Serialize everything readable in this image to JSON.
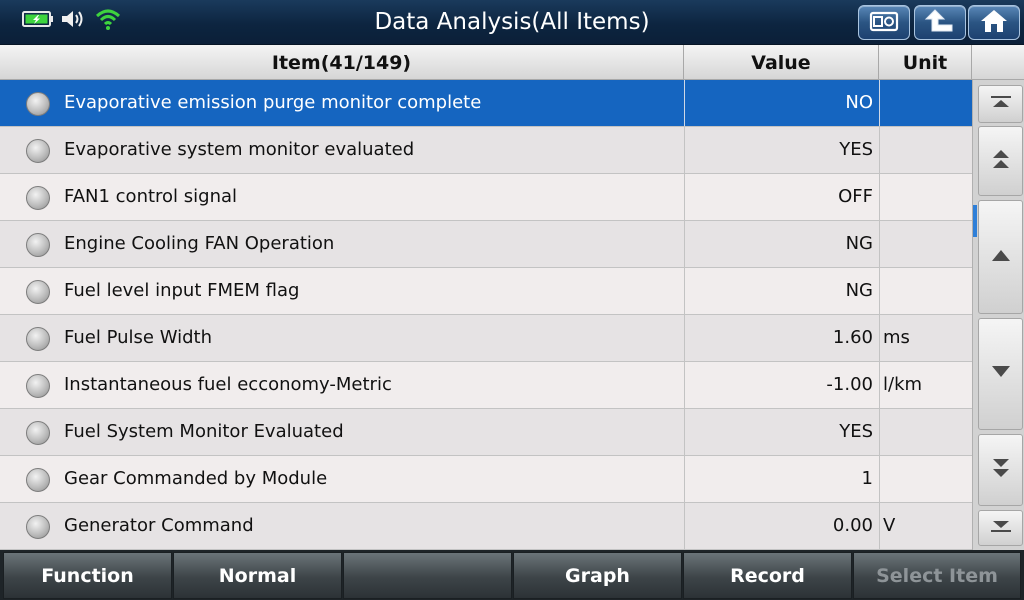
{
  "window": {
    "title": "Data Analysis(All Items)"
  },
  "status_icons": [
    "battery-charging-icon",
    "speaker-icon",
    "wifi-icon"
  ],
  "toolbar": {
    "buttons": [
      "screenshot-icon",
      "upload-icon",
      "home-icon"
    ]
  },
  "table": {
    "headers": {
      "item": "Item(41/149)",
      "value": "Value",
      "unit": "Unit"
    },
    "selected_index": 0,
    "rows": [
      {
        "item": "Evaporative emission purge monitor complete",
        "value": "NO",
        "unit": ""
      },
      {
        "item": "Evaporative system monitor evaluated",
        "value": "YES",
        "unit": ""
      },
      {
        "item": "FAN1 control signal",
        "value": "OFF",
        "unit": ""
      },
      {
        "item": "Engine Cooling FAN Operation",
        "value": "NG",
        "unit": ""
      },
      {
        "item": "Fuel level input FMEM flag",
        "value": "NG",
        "unit": ""
      },
      {
        "item": "Fuel Pulse Width",
        "value": "1.60",
        "unit": "ms"
      },
      {
        "item": "Instantaneous fuel ecconomy-Metric",
        "value": "-1.00",
        "unit": "l/km"
      },
      {
        "item": "Fuel System Monitor Evaluated",
        "value": "YES",
        "unit": ""
      },
      {
        "item": "Gear Commanded by Module",
        "value": "1",
        "unit": ""
      },
      {
        "item": "Generator Command",
        "value": "0.00",
        "unit": "V"
      }
    ]
  },
  "scroll_buttons": [
    "scroll-top-icon",
    "page-up-icon",
    "line-up-icon",
    "line-down-icon",
    "page-down-icon",
    "scroll-bottom-icon"
  ],
  "bottom_bar": {
    "function": "Function",
    "normal": "Normal",
    "blank": "",
    "graph": "Graph",
    "record": "Record",
    "select_item": "Select Item"
  },
  "colors": {
    "selected_row": "#1565c0",
    "title_bar": "#0d2540",
    "wifi": "#3ed43e",
    "battery": "#3ed43e"
  }
}
